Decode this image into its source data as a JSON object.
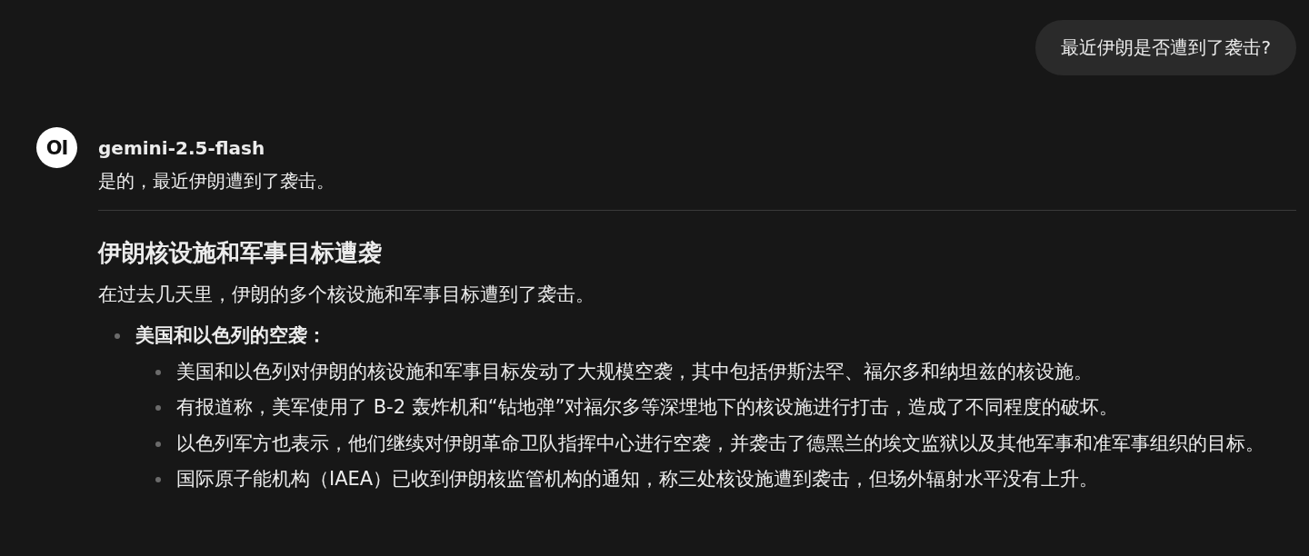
{
  "user_message": {
    "text": "最近伊朗是否遭到了袭击?"
  },
  "assistant": {
    "avatar": "OI",
    "model": "gemini-2.5-flash",
    "intro": "是的，最近伊朗遭到了袭击。",
    "heading": "伊朗核设施和军事目标遭袭",
    "paragraph": "在过去几天里，伊朗的多个核设施和军事目标遭到了袭击。",
    "list": [
      {
        "text": "美国和以色列的空袭：",
        "children": [
          {
            "text": "美国和以色列对伊朗的核设施和军事目标发动了大规模空袭，其中包括伊斯法罕、福尔多和纳坦兹的核设施。"
          },
          {
            "text": "有报道称，美军使用了 B-2 轰炸机和“钻地弹”对福尔多等深埋地下的核设施进行打击，造成了不同程度的破坏。"
          },
          {
            "text": "以色列军方也表示，他们继续对伊朗革命卫队指挥中心进行空袭，并袭击了德黑兰的埃文监狱以及其他军事和准军事组织的目标。"
          },
          {
            "text": "国际原子能机构（IAEA）已收到伊朗核监管机构的通知，称三处核设施遭到袭击，但场外辐射水平没有上升。"
          }
        ]
      }
    ]
  }
}
